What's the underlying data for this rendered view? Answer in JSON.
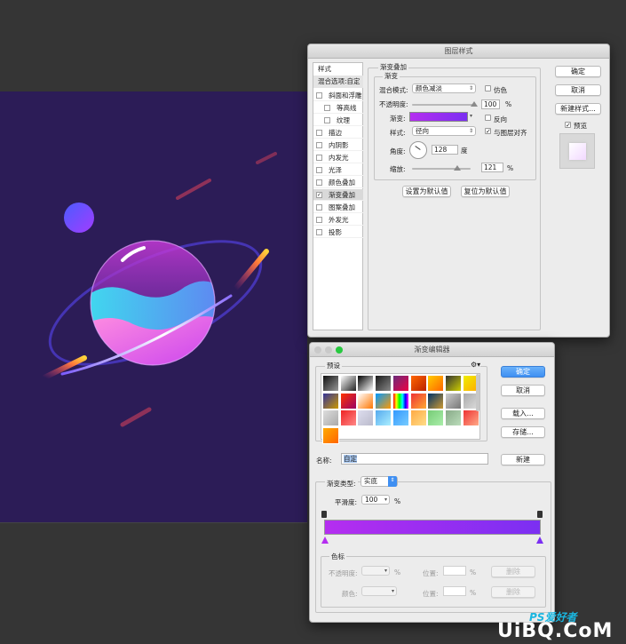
{
  "colors": {
    "artboard_bg": "#2c1c57",
    "gradient_start": "#b52ef0",
    "gradient_end": "#7b2ff2"
  },
  "layer_style": {
    "title": "图层样式",
    "sidebar": {
      "header": "样式",
      "blend_options": "混合选项:自定",
      "items": [
        {
          "label": "斜面和浮雕",
          "checked": false
        },
        {
          "label": "等高线",
          "checked": false
        },
        {
          "label": "纹理",
          "checked": false
        },
        {
          "label": "描边",
          "checked": false
        },
        {
          "label": "内阴影",
          "checked": false
        },
        {
          "label": "内发光",
          "checked": false
        },
        {
          "label": "光泽",
          "checked": false
        },
        {
          "label": "颜色叠加",
          "checked": false
        },
        {
          "label": "渐变叠加",
          "checked": true
        },
        {
          "label": "图案叠加",
          "checked": false
        },
        {
          "label": "外发光",
          "checked": false
        },
        {
          "label": "投影",
          "checked": false
        }
      ]
    },
    "panel": {
      "section_title": "渐变叠加",
      "group_title": "渐变",
      "blend_mode_label": "混合模式:",
      "blend_mode_value": "颜色减淡",
      "dither_label": "仿色",
      "opacity_label": "不透明度:",
      "opacity_value": "100",
      "percent": "%",
      "gradient_label": "渐变:",
      "reverse_label": "反向",
      "style_label": "样式:",
      "style_value": "径向",
      "align_label": "与图层对齐",
      "angle_label": "角度:",
      "angle_value": "128",
      "degree_unit": "度",
      "scale_label": "缩放:",
      "scale_value": "121",
      "scale_fraction": 0.6,
      "set_default": "设置为默认值",
      "reset_default": "复位为默认值"
    },
    "buttons": {
      "ok": "确定",
      "cancel": "取消",
      "new_style": "新建样式...",
      "preview": "预览"
    }
  },
  "gradient_editor": {
    "title": "渐变编辑器",
    "presets_label": "预设",
    "buttons": {
      "ok": "确定",
      "cancel": "取消",
      "load": "载入...",
      "save": "存储...",
      "new": "新建",
      "delete": "删除"
    },
    "name_label": "名称:",
    "name_value": "自定",
    "type_label": "渐变类型:",
    "type_value": "实底",
    "smoothness_label": "平滑度:",
    "smoothness_value": "100",
    "percent": "%",
    "stops_group": "色标",
    "stop_opacity_label": "不透明度:",
    "stop_color_label": "颜色:",
    "location_label": "位置:",
    "preset_swatches": [
      "linear-gradient(135deg,#111,#999)",
      "linear-gradient(135deg,#fff,#222)",
      "linear-gradient(135deg,#000,#fff)",
      "linear-gradient(135deg,#1a1a1a,#888)",
      "linear-gradient(135deg,#6b2b7a,#e04)",
      "linear-gradient(135deg,#f60,#b20)",
      "linear-gradient(135deg,#fc0,#f60)",
      "linear-gradient(135deg,#333,#cc0)",
      "linear-gradient(135deg,#ee0,#fa0)",
      "linear-gradient(135deg,#339,#c90)",
      "linear-gradient(135deg,#f30,#906)",
      "linear-gradient(135deg,#fff,#f70)",
      "linear-gradient(135deg,#09f,#f90)",
      "linear-gradient(90deg,#f00,#ff0,#0f0,#0ff,#00f,#f0f)",
      "linear-gradient(135deg,#e33,#fa3)",
      "linear-gradient(135deg,#036,#c93)",
      "linear-gradient(135deg,#ccc,#777)",
      "linear-gradient(135deg,#aaa,#ddd)",
      "linear-gradient(135deg,#ddd,#aaa)",
      "linear-gradient(135deg,#e22,#f88)",
      "linear-gradient(135deg,#dde,#bbc)",
      "linear-gradient(135deg,#5ae,#aef)",
      "linear-gradient(135deg,#39f,#7cf)",
      "linear-gradient(135deg,#fa4,#fd8)",
      "linear-gradient(135deg,#7c7,#aea)",
      "linear-gradient(135deg,#8a8,#bdb)",
      "linear-gradient(135deg,#e33,#fa8)",
      "linear-gradient(135deg,#fa0,#f60)"
    ]
  },
  "watermark": {
    "text": "PS爱好者",
    "site": "UiBQ.CoM"
  }
}
